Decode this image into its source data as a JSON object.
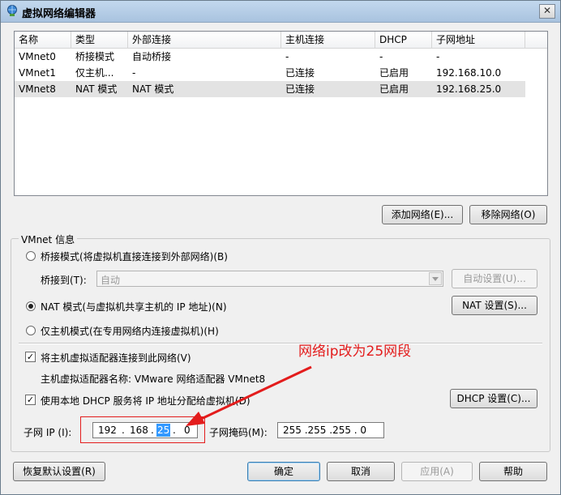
{
  "window": {
    "title": "虚拟网络编辑器",
    "close_glyph": "✕"
  },
  "table": {
    "columns": [
      "名称",
      "类型",
      "外部连接",
      "主机连接",
      "DHCP",
      "子网地址"
    ],
    "rows": [
      {
        "name": "VMnet0",
        "type": "桥接模式",
        "external": "自动桥接",
        "host": "-",
        "dhcp": "-",
        "subnet": "-",
        "selected": false
      },
      {
        "name": "VMnet1",
        "type": "仅主机...",
        "external": "-",
        "host": "已连接",
        "dhcp": "已启用",
        "subnet": "192.168.10.0",
        "selected": false
      },
      {
        "name": "VMnet8",
        "type": "NAT 模式",
        "external": "NAT 模式",
        "host": "已连接",
        "dhcp": "已启用",
        "subnet": "192.168.25.0",
        "selected": true
      }
    ]
  },
  "buttons": {
    "add_network": "添加网络(E)...",
    "remove_network": "移除网络(O)",
    "auto_settings": "自动设置(U)...",
    "nat_settings": "NAT 设置(S)...",
    "dhcp_settings": "DHCP 设置(C)...",
    "restore_defaults": "恢复默认设置(R)",
    "ok": "确定",
    "cancel": "取消",
    "apply": "应用(A)",
    "help": "帮助"
  },
  "vmnet_info": {
    "group_label": "VMnet 信息",
    "bridged_label": "桥接模式(将虚拟机直接连接到外部网络)(B)",
    "bridged_to_label": "桥接到(T):",
    "bridged_to_value": "自动",
    "nat_label": "NAT 模式(与虚拟机共享主机的 IP 地址)(N)",
    "hostonly_label": "仅主机模式(在专用网络内连接虚拟机)(H)",
    "selected_mode": "nat",
    "connect_adapter_label": "将主机虚拟适配器连接到此网络(V)",
    "connect_adapter_checked": true,
    "adapter_name_label": "主机虚拟适配器名称: VMware 网络适配器 VMnet8",
    "use_dhcp_label": "使用本地 DHCP 服务将 IP 地址分配给虚拟机(D)",
    "use_dhcp_checked": true,
    "subnet_ip_label": "子网 IP (I):",
    "subnet_ip": [
      "192",
      "168",
      "25",
      "0"
    ],
    "subnet_mask_label": "子网掩码(M):",
    "subnet_mask": "255 .255 .255 . 0"
  },
  "annotation": {
    "text": "网络ip改为25网段",
    "color": "#e31c1c"
  },
  "check_glyph": "✓"
}
